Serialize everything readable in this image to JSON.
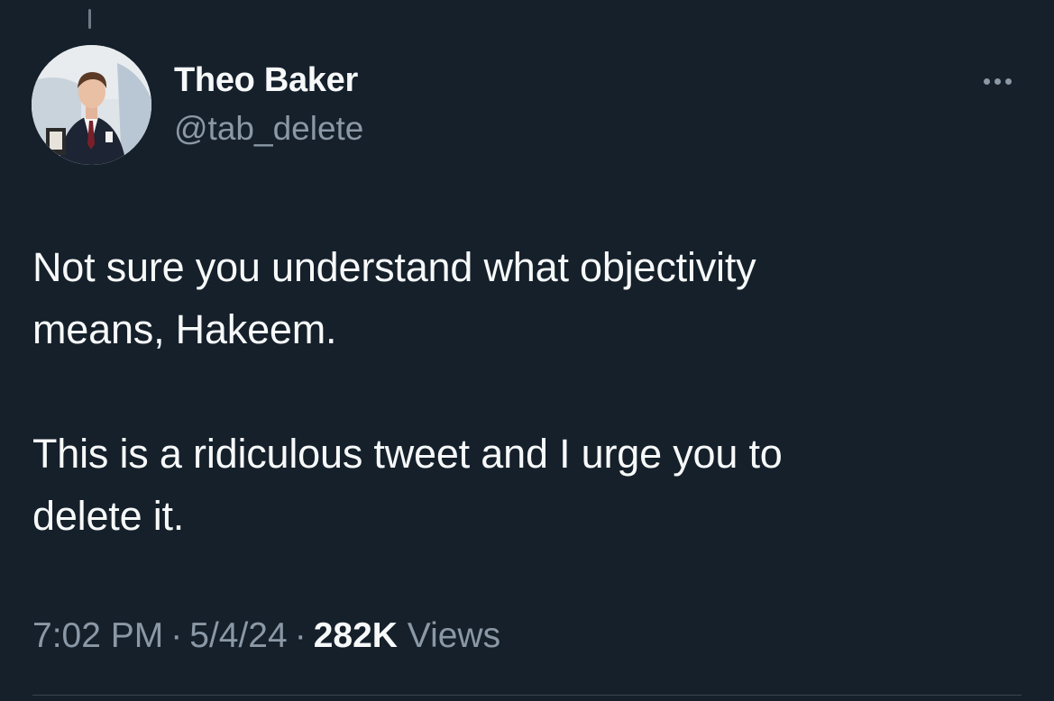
{
  "tweet": {
    "author": {
      "display_name": "Theo Baker",
      "handle": "@tab_delete"
    },
    "text_paragraphs": [
      "Not sure you understand what objectivity\nmeans, Hakeem.",
      "This is a ridiculous tweet and I urge you to\ndelete it."
    ],
    "time": "7:02 PM",
    "date": "5/4/24",
    "separator": "·",
    "views_count": "282K",
    "views_label": "Views"
  },
  "icons": {
    "more": "more-horizontal-icon",
    "avatar": "profile-photo"
  },
  "colors": {
    "background": "#15202b",
    "primary_text": "#f7f9f9",
    "secondary_text": "#8b98a5"
  }
}
